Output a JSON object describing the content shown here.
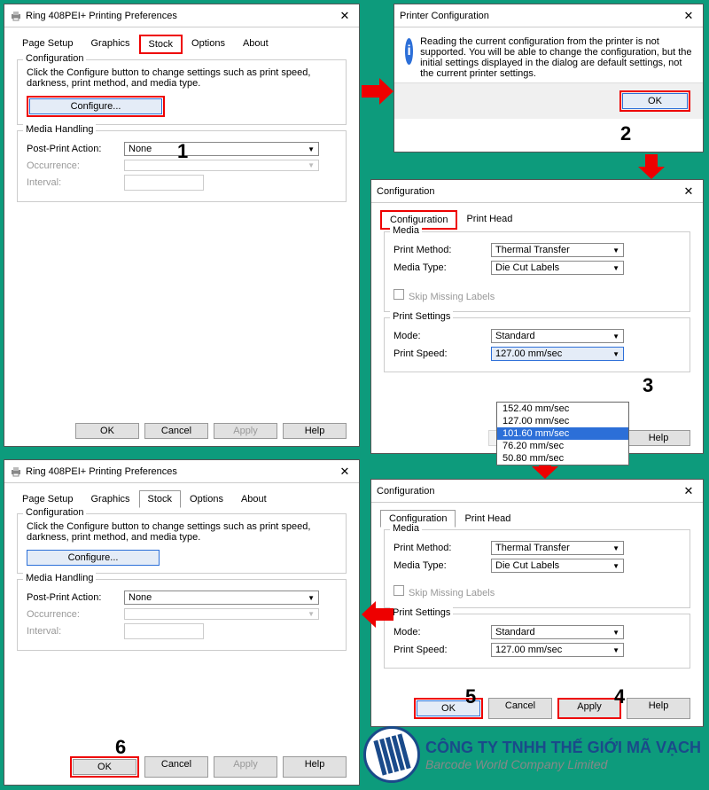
{
  "w1": {
    "title": "Ring 408PEI+ Printing Preferences",
    "tabs": [
      "Page Setup",
      "Graphics",
      "Stock",
      "Options",
      "About"
    ],
    "cfgGroup": "Configuration",
    "cfgText": "Click the Configure button to change settings such as print speed, darkness, print method, and media type.",
    "cfgBtn": "Configure...",
    "mhGroup": "Media Handling",
    "ppa": "Post-Print Action:",
    "ppaVal": "None",
    "occ": "Occurrence:",
    "intv": "Interval:",
    "ok": "OK",
    "cancel": "Cancel",
    "apply": "Apply",
    "help": "Help"
  },
  "w2": {
    "title": "Printer Configuration",
    "msg": "Reading the current configuration from the printer is not supported. You will be able to change the configuration, but the initial settings displayed in the dialog are default settings, not the current printer settings.",
    "ok": "OK"
  },
  "w3": {
    "title": "Configuration",
    "tabs": [
      "Configuration",
      "Print Head"
    ],
    "media": "Media",
    "pm": "Print Method:",
    "pmVal": "Thermal Transfer",
    "mt": "Media Type:",
    "mtVal": "Die Cut Labels",
    "skip": "Skip Missing Labels",
    "ps": "Print Settings",
    "mode": "Mode:",
    "modeVal": "Standard",
    "speed": "Print Speed:",
    "speedVal": "127.00 mm/sec",
    "opts": [
      "152.40 mm/sec",
      "127.00 mm/sec",
      "101.60 mm/sec",
      "76.20 mm/sec",
      "50.80 mm/sec"
    ],
    "ok": "OK",
    "cancel": "Cancel",
    "apply": "Apply",
    "help": "Help"
  },
  "logo": {
    "t1": "CÔNG TY TNHH THẾ GIỚI MÃ VẠCH",
    "t2": "Barcode World Company Limited"
  },
  "nums": {
    "n1": "1",
    "n2": "2",
    "n3": "3",
    "n4": "4",
    "n5": "5",
    "n6": "6"
  }
}
